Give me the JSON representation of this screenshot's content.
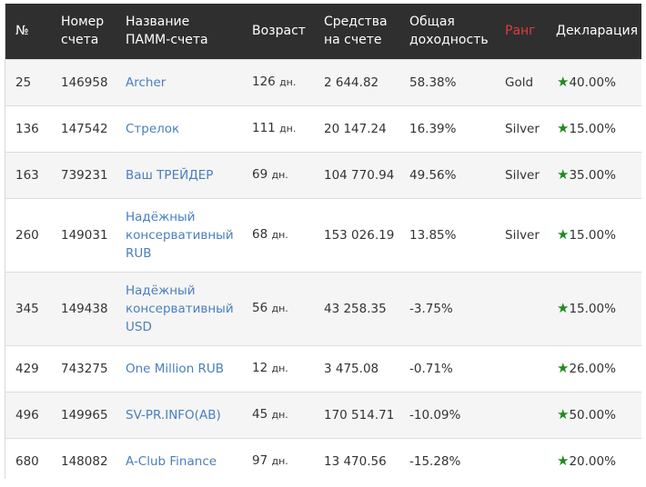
{
  "headers": {
    "num": "№",
    "account": [
      "Номер",
      "счета"
    ],
    "name": [
      "Название",
      "ПАММ-счета"
    ],
    "age": "Возраст",
    "funds": [
      "Средства",
      "на счете"
    ],
    "yield": [
      "Общая",
      "доходность"
    ],
    "rank": "Ранг",
    "declaration": "Декларация"
  },
  "colors": {
    "header_bg": "#2f2f2f",
    "rank_header": "#e23b3b",
    "link": "#4a7fbd",
    "star": "#1f8a1f"
  },
  "age_unit": "дн.",
  "star_icon": "star-icon",
  "rows": [
    {
      "num": "25",
      "account": "146958",
      "name": [
        "Archer"
      ],
      "age": "126",
      "funds": "2 644.82",
      "yield": "58.38%",
      "rank": "Gold",
      "declaration": "40.00%"
    },
    {
      "num": "136",
      "account": "147542",
      "name": [
        "Стрелок"
      ],
      "age": "111",
      "funds": "20 147.24",
      "yield": "16.39%",
      "rank": "Silver",
      "declaration": "15.00%"
    },
    {
      "num": "163",
      "account": "739231",
      "name": [
        "Ваш ТРЕЙДЕР"
      ],
      "age": "69",
      "funds": "104 770.94",
      "yield": "49.56%",
      "rank": "Silver",
      "declaration": "35.00%"
    },
    {
      "num": "260",
      "account": "149031",
      "name": [
        "Надёжный",
        "консервативный",
        "RUB"
      ],
      "age": "68",
      "funds": "153 026.19",
      "yield": "13.85%",
      "rank": "Silver",
      "declaration": "15.00%"
    },
    {
      "num": "345",
      "account": "149438",
      "name": [
        "Надёжный",
        "консервативный",
        "USD"
      ],
      "age": "56",
      "funds": "43 258.35",
      "yield": "-3.75%",
      "rank": "",
      "declaration": "15.00%"
    },
    {
      "num": "429",
      "account": "743275",
      "name": [
        "One Million RUB"
      ],
      "age": "12",
      "funds": "3 475.08",
      "yield": "-0.71%",
      "rank": "",
      "declaration": "26.00%"
    },
    {
      "num": "496",
      "account": "149965",
      "name": [
        "SV-PR.INFO(AB)"
      ],
      "age": "45",
      "funds": "170 514.71",
      "yield": "-10.09%",
      "rank": "",
      "declaration": "50.00%"
    },
    {
      "num": "680",
      "account": "148082",
      "name": [
        "A-Club Finance"
      ],
      "age": "97",
      "funds": "13 470.56",
      "yield": "-15.28%",
      "rank": "",
      "declaration": "20.00%"
    }
  ]
}
